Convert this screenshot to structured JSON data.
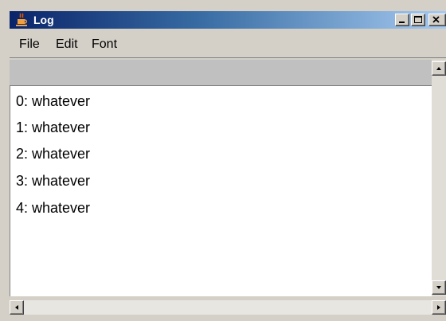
{
  "window": {
    "title": "Log",
    "icon": "java-cup-icon",
    "controls": [
      "minimize-icon",
      "maximize-icon",
      "close-icon"
    ]
  },
  "menu": {
    "items": [
      {
        "label": "File"
      },
      {
        "label": "Edit"
      },
      {
        "label": "Font"
      }
    ]
  },
  "log": {
    "lines": [
      "0: whatever",
      "1: whatever",
      "2: whatever",
      "3: whatever",
      "4: whatever"
    ]
  },
  "colors": {
    "titlebar_start": "#0a246a",
    "titlebar_end": "#a6caf0",
    "window_face": "#d4d0c8",
    "content_bg": "#ffffff"
  }
}
